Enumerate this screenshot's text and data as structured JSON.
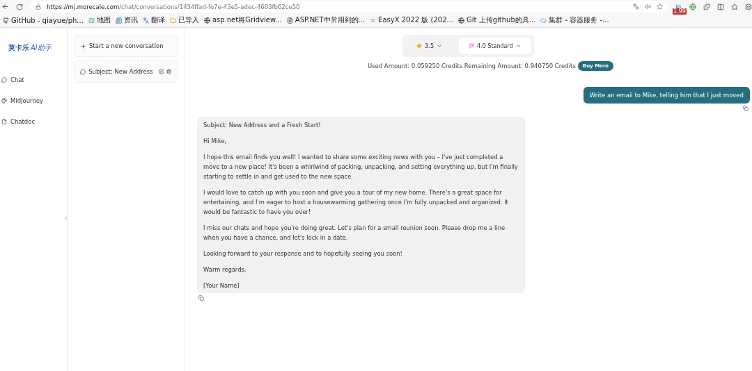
{
  "browser": {
    "url_host": "https://mj.morecale.com",
    "url_path": "/chat/conversations/1434ffad-fe7e-43e5-adec-4603fb62ce50",
    "extension_badge": "1.99",
    "bookmarks": [
      {
        "label": "GitHub - qiayue/ph...",
        "kind": "github"
      },
      {
        "label": "地图",
        "kind": "map"
      },
      {
        "label": "资讯",
        "kind": "news"
      },
      {
        "label": "翻译",
        "kind": "translate"
      },
      {
        "label": "已导入",
        "kind": "folder"
      },
      {
        "label": "asp.net将Gridview...",
        "kind": "swirl"
      },
      {
        "label": "ASP.NET中常用到的...",
        "kind": "page"
      },
      {
        "label": "EasyX 2022 版 (202...",
        "kind": "x"
      },
      {
        "label": "Git 上传github的具...",
        "kind": "swirl"
      },
      {
        "label": "集群 - 容器服务 -...",
        "kind": "cloud"
      }
    ]
  },
  "logo": {
    "brand": "莫卡乐",
    "tagline": "AI助手"
  },
  "nav": [
    {
      "label": "Chat",
      "kind": "chat"
    },
    {
      "label": "Midjourney",
      "kind": "palette"
    },
    {
      "label": "Chatdoc",
      "kind": "doc"
    }
  ],
  "conversations": {
    "new_label": "Start a new conversation",
    "items": [
      {
        "title": "Subject: New Address"
      }
    ]
  },
  "models": [
    {
      "label": "3.5",
      "kind": "bolt",
      "selected": false
    },
    {
      "label": "4.0 Standard",
      "kind": "wand",
      "selected": true
    }
  ],
  "usage": {
    "text": "Used Amount: 0.059250 Credits Remaining Amount: 0.940750 Credits",
    "button": "Buy More"
  },
  "messages": [
    {
      "kind": "user",
      "paragraphs": [
        "Write an email to Mike, telling him that I just moved"
      ]
    },
    {
      "kind": "assistant",
      "paragraphs": [
        "Subject: New Address and a Fresh Start!",
        "Hi Mike,",
        "I hope this email finds you well! I wanted to share some exciting news with you – I've just completed a move to a new place! It's been a whirlwind of packing, unpacking, and setting everything up, but I'm finally starting to settle in and get used to the new space.",
        "I would love to catch up with you soon and give you a tour of my new home. There's a great space for entertaining, and I'm eager to host a housewarming gathering once I'm fully unpacked and organized. It would be fantastic to have you over!",
        "I miss our chats and hope you're doing great. Let's plan for a small reunion soon. Please drop me a line when you have a chance, and let's lock in a date.",
        "Looking forward to your response and to hopefully seeing you soon!",
        "Warm regards,",
        "[Your Name]"
      ]
    }
  ]
}
